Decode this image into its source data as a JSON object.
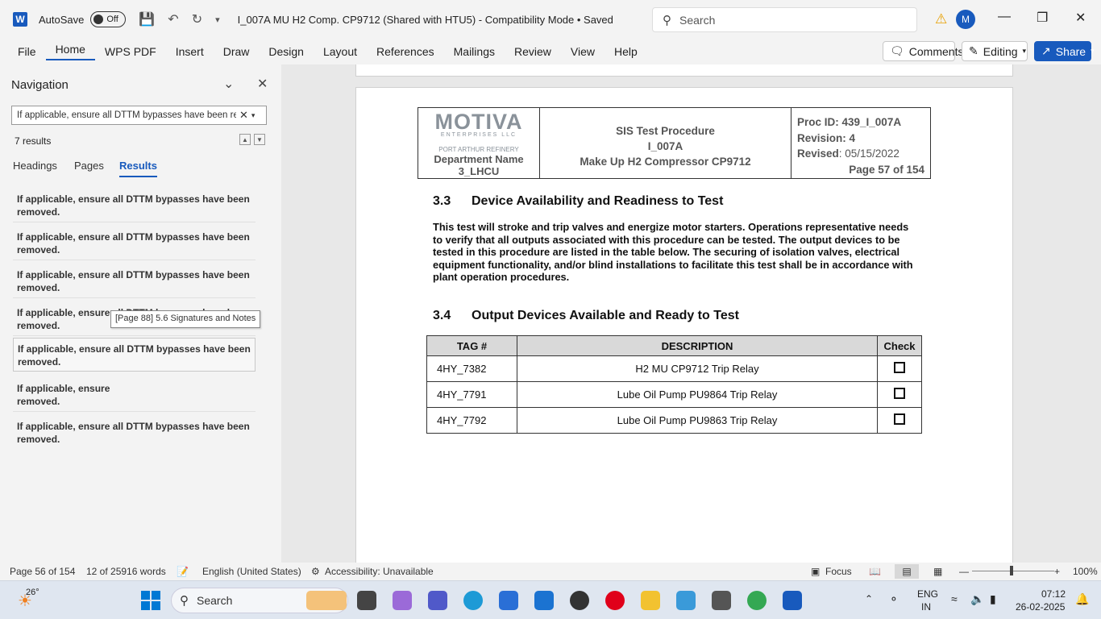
{
  "titlebar": {
    "autosave_label": "AutoSave",
    "autosave_state": "Off",
    "document_title": "I_007A MU H2 Comp. CP9712 (Shared with HTU5)  -  Compatibility Mode • Saved",
    "search_placeholder": "Search",
    "avatar_initial": "M"
  },
  "menu": {
    "items": [
      "File",
      "Home",
      "WPS PDF",
      "Insert",
      "Draw",
      "Design",
      "Layout",
      "References",
      "Mailings",
      "Review",
      "View",
      "Help"
    ],
    "comments": "Comments",
    "editing": "Editing",
    "share": "Share"
  },
  "navigation": {
    "title": "Navigation",
    "search_value": "If applicable, ensure all DTTM bypasses have been re",
    "results_count": "7 results",
    "tabs": [
      "Headings",
      "Pages",
      "Results"
    ],
    "results": [
      "If applicable, ensure all DTTM bypasses have been removed.",
      "If applicable, ensure all DTTM bypasses have been removed.",
      "If applicable, ensure all DTTM bypasses have been removed.",
      "If applicable, ensure all DTTM bypasses have been removed.",
      "If applicable, ensure all DTTM bypasses have been removed.",
      "If applicable, ensure all DTTM bypasses have been removed.",
      "If applicable, ensure all DTTM bypasses have been removed."
    ],
    "tooltip": "[Page 88]  5.6 Signatures and Notes",
    "result6_visible_start": "If applicable, ensure",
    "result6_visible_end": "removed."
  },
  "document": {
    "header": {
      "logo": "MOTIVA",
      "logo_sub": "ENTERPRISES LLC",
      "refinery": "PORT ARTHUR REFINERY",
      "department_label": "Department Name",
      "department_value": "3_LHCU",
      "title_line1": "SIS Test Procedure",
      "title_line2": "I_007A",
      "title_line3": "Make Up H2 Compressor CP9712",
      "proc_id": "Proc ID: 439_I_007A",
      "revision": "Revision: 4",
      "revised_label": "Revised",
      "revised_value": ": 05/15/2022",
      "page": "Page 57 of 154"
    },
    "section1_num": "3.3",
    "section1_title": "Device Availability and Readiness to Test",
    "section1_text": "This test will stroke and trip valves and energize motor starters. Operations representative needs to verify that all outputs associated with this procedure can be tested.  The output devices to be tested in this procedure are listed in the table below.  The securing of isolation valves, electrical equipment functionality, and/or blind installations to facilitate this test shall be in accordance with plant operation procedures.",
    "section2_num": "3.4",
    "section2_title": "Output Devices Available and Ready to Test",
    "table": {
      "headers": [
        "TAG #",
        "DESCRIPTION",
        "Check"
      ],
      "rows": [
        {
          "tag": "4HY_7382",
          "desc": "H2 MU CP9712 Trip Relay"
        },
        {
          "tag": "4HY_7791",
          "desc": "Lube Oil Pump PU9864 Trip Relay"
        },
        {
          "tag": "4HY_7792",
          "desc": "Lube Oil Pump PU9863 Trip Relay"
        }
      ]
    }
  },
  "status": {
    "page": "Page 56 of 154",
    "words": "12 of 25916 words",
    "language": "English (United States)",
    "accessibility": "Accessibility: Unavailable",
    "focus": "Focus",
    "zoom": "100%"
  },
  "taskbar": {
    "temp": "26°",
    "search": "Search",
    "lang1": "ENG",
    "lang2": "IN",
    "time": "07:12",
    "date": "26-02-2025"
  },
  "colors": {
    "accent": "#185abd",
    "warning": "#e8a000"
  }
}
